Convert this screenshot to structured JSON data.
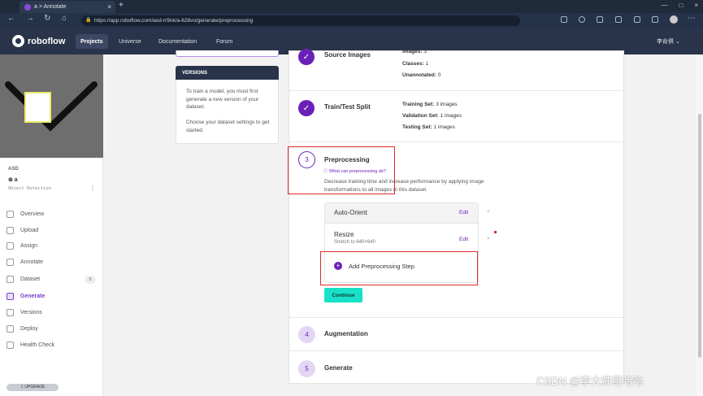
{
  "browser": {
    "tab_title": "a > Annotate",
    "tab_close": "×",
    "new_tab": "+",
    "url": "https://app.roboflow.com/asd-rr9nk/a-628vo/generate/preprocessing",
    "window_controls": [
      "—",
      "□",
      "×"
    ]
  },
  "nav": {
    "logo_text": "roboflow",
    "links": [
      "Projects",
      "Universe",
      "Documentation",
      "Forum"
    ],
    "user": "李俞俱 ⌄"
  },
  "project": {
    "workspace": "ASD",
    "name": "⊕ a",
    "type": "Object Detection",
    "more": "⋮"
  },
  "sidebar": {
    "items": [
      {
        "label": "Overview",
        "icon": "overview-icon"
      },
      {
        "label": "Upload",
        "icon": "upload-icon"
      },
      {
        "label": "Assign",
        "icon": "assign-icon"
      },
      {
        "label": "Annotate",
        "icon": "annotate-icon"
      },
      {
        "label": "Dataset",
        "icon": "dataset-icon"
      },
      {
        "label": "Generate",
        "icon": "generate-icon"
      },
      {
        "label": "Versions",
        "icon": "versions-icon"
      },
      {
        "label": "Deploy",
        "icon": "deploy-icon"
      },
      {
        "label": "Health Check",
        "icon": "health-check-icon"
      }
    ],
    "dataset_count": "5",
    "upgrade": "⇧ UPGRADE"
  },
  "versions": {
    "header": "VERSIONS",
    "text1": "To train a model, you must first generate a new version of your dataset.",
    "text2": "Choose your dataset settings to get started."
  },
  "steps": {
    "source": {
      "title": "Source Images",
      "stats": [
        {
          "label": "Images:",
          "value": "3"
        },
        {
          "label": "Classes:",
          "value": "1"
        },
        {
          "label": "Unannotated:",
          "value": "0"
        }
      ]
    },
    "split": {
      "title": "Train/Test Split",
      "stats": [
        {
          "label": "Training Set:",
          "value": "3 images"
        },
        {
          "label": "Validation Set:",
          "value": "1 images"
        },
        {
          "label": "Testing Set:",
          "value": "1 images"
        }
      ]
    },
    "preprocessing": {
      "number": "3",
      "title": "Preprocessing",
      "help": "ⓘ What can preprocessing do?",
      "description": "Decrease training time and increase performance by applying image transformations to all images in this dataset.",
      "items": [
        {
          "label": "Auto-Orient",
          "sub": "",
          "edit": "Edit",
          "remove": "×"
        },
        {
          "label": "Resize",
          "sub": "Stretch to 640×640",
          "edit": "Edit",
          "remove": "×"
        }
      ],
      "add_step": "Add Preprocessing Step",
      "continue": "Continue"
    },
    "augmentation": {
      "number": "4",
      "title": "Augmentation"
    },
    "generate": {
      "number": "5",
      "title": "Generate"
    }
  },
  "check_mark": "✓",
  "watermark": "CSDN @李大帅哥哈哈",
  "colors": {
    "accent": "#6a20b8",
    "nav_bg": "#29334a",
    "continue": "#19e0c8",
    "highlight": "#e02a2a"
  }
}
